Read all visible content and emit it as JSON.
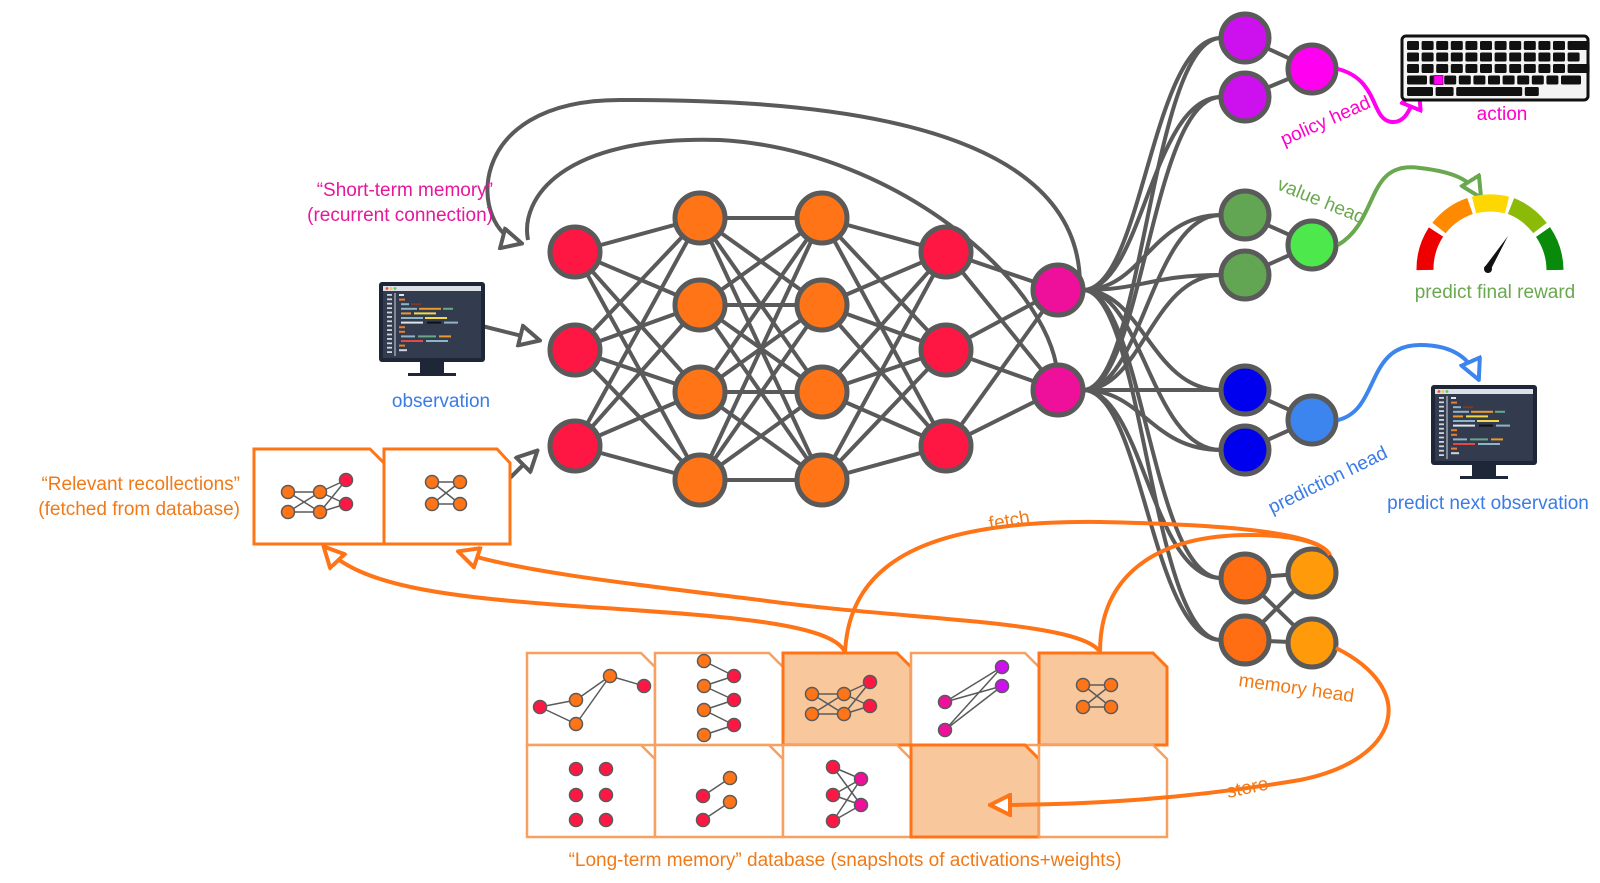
{
  "labels": {
    "short_term_memory_line1": "“Short-term memory”",
    "short_term_memory_line2": "(recurrent connection)",
    "observation": "observation",
    "relevant_recollections_line1": "“Relevant recollections”",
    "relevant_recollections_line2": "(fetched from database)",
    "policy_head": "policy head",
    "action": "action",
    "value_head": "value head",
    "predict_final_reward": "predict final reward",
    "prediction_head": "prediction head",
    "predict_next_observation": "predict next observation",
    "memory_head": "memory head",
    "fetch": "fetch",
    "store": "store",
    "long_term_memory": "“Long-term memory” database (snapshots of activations+weights)"
  },
  "colors": {
    "magenta_label": "#e6179b",
    "blue_label": "#3a7be8",
    "orange_label": "#f07a18",
    "green_label": "#6aa84f",
    "policy_label": "#ff00cc",
    "edge": "#5a5a5a",
    "red_node": "#ff1744",
    "orange_node": "#ff7417",
    "pink_node": "#ee0f9a",
    "purple_node": "#cc11ee",
    "bright_magenta_node": "#ff00f0",
    "green_node": "#62a552",
    "light_green_node": "#4ce84c",
    "blue_node": "#0000ee",
    "light_blue_node": "#3d85ee",
    "memory_node_dark": "#ff6e12",
    "memory_node_light": "#ff9b0a",
    "db_fill": "#f8c89c"
  },
  "network": {
    "layers": [
      3,
      4,
      4,
      3,
      2
    ]
  },
  "heads": [
    "policy head",
    "value head",
    "prediction head",
    "memory head"
  ],
  "database": {
    "rows": 2,
    "cols": 5,
    "highlighted_cells": [
      "r0c2",
      "r0c4",
      "r1c3"
    ]
  }
}
